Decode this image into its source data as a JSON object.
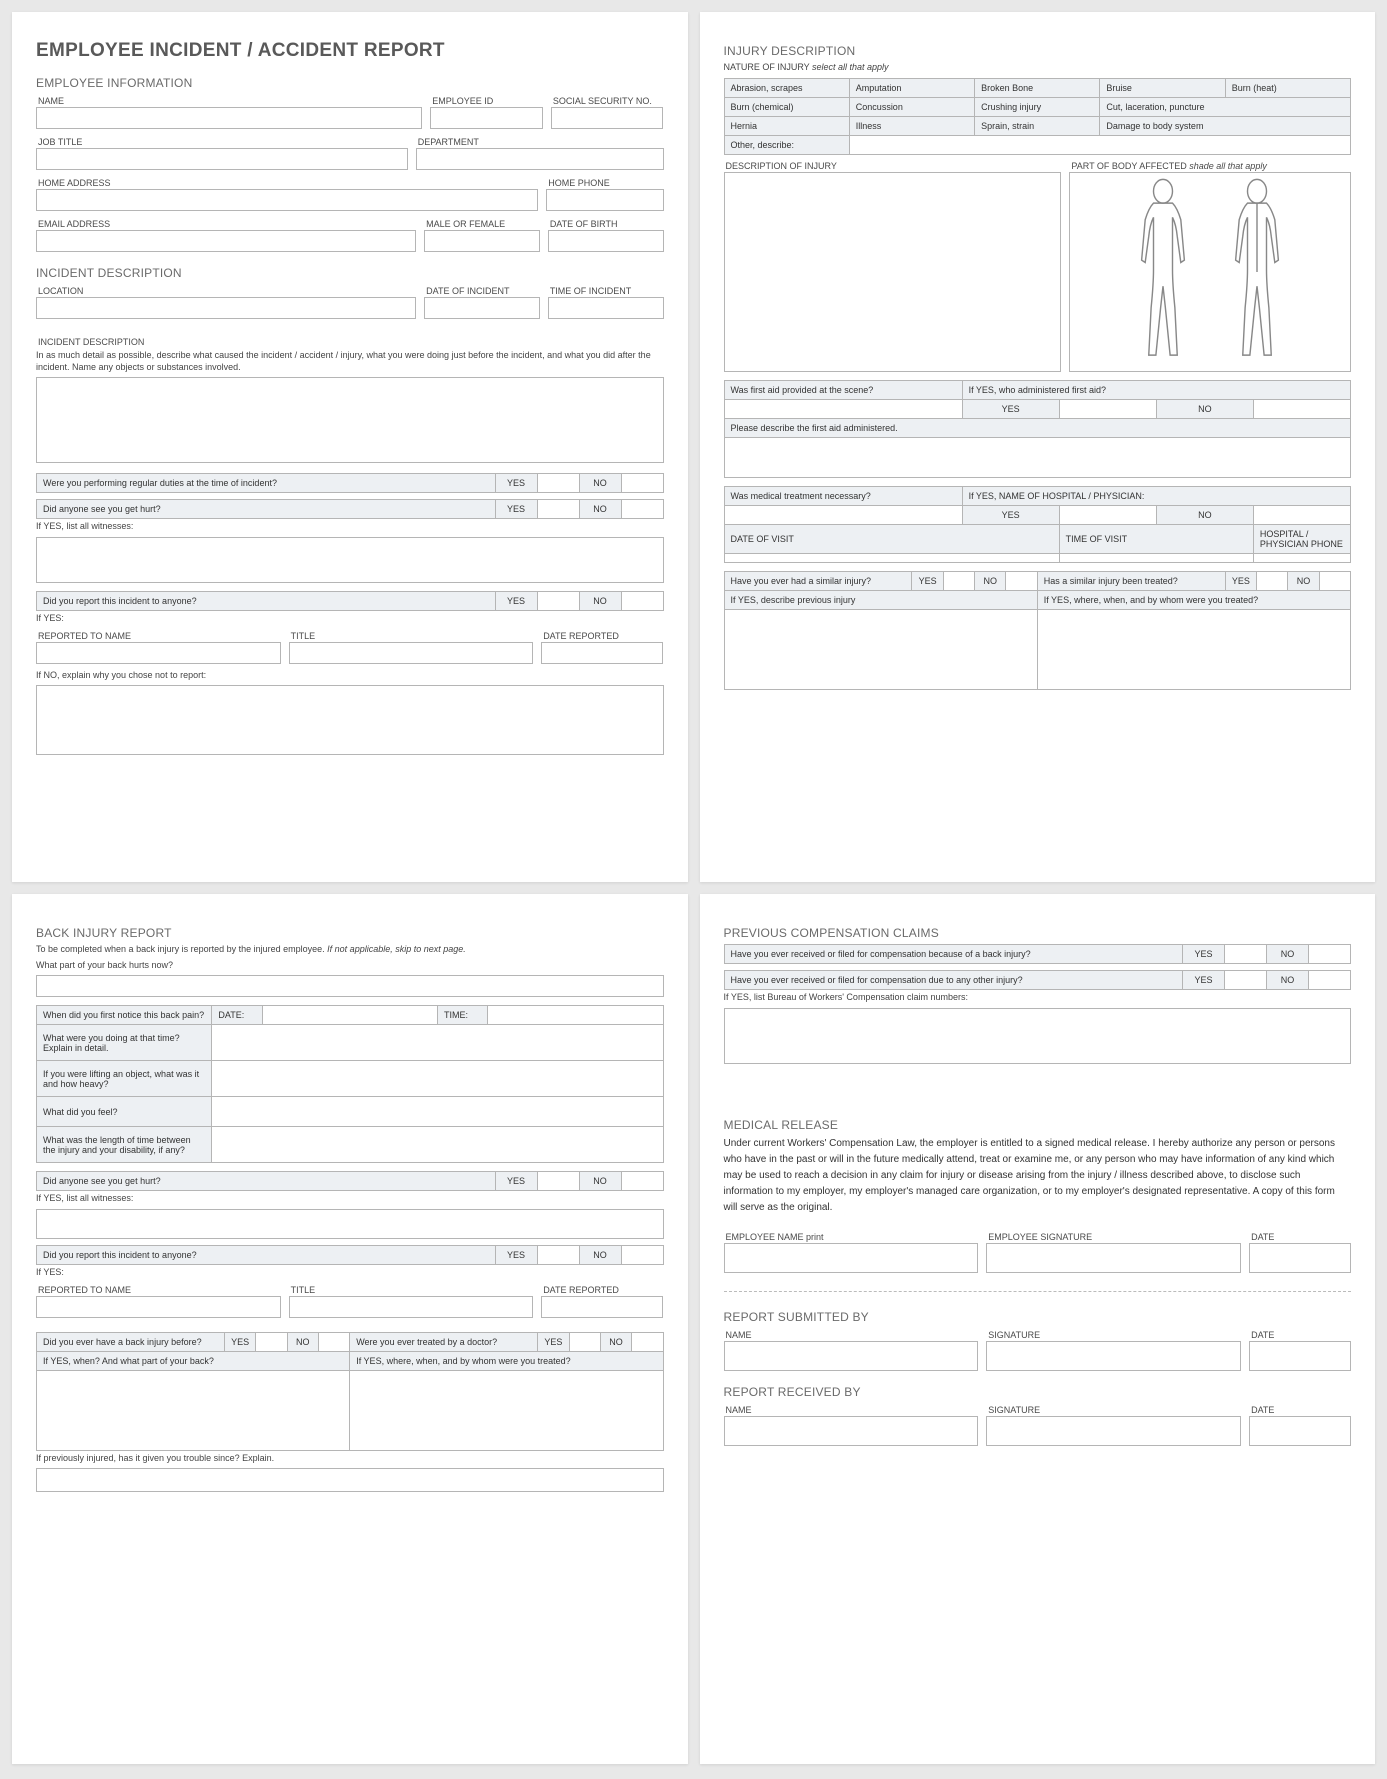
{
  "title": "EMPLOYEE INCIDENT / ACCIDENT REPORT",
  "sections": {
    "emp_info": "EMPLOYEE INFORMATION",
    "incident_desc": "INCIDENT DESCRIPTION",
    "back_injury": "BACK INJURY REPORT",
    "injury_desc": "INJURY DESCRIPTION",
    "prev_comp": "PREVIOUS COMPENSATION CLAIMS",
    "med_release": "MEDICAL RELEASE",
    "submitted": "REPORT SUBMITTED BY",
    "received": "REPORT RECEIVED BY"
  },
  "labels": {
    "name": "NAME",
    "emp_id": "EMPLOYEE ID",
    "ssn": "SOCIAL SECURITY NO.",
    "job_title": "JOB TITLE",
    "department": "DEPARTMENT",
    "home_addr": "HOME ADDRESS",
    "home_phone": "HOME PHONE",
    "email": "EMAIL ADDRESS",
    "mf": "MALE OR FEMALE",
    "dob": "DATE OF BIRTH",
    "location": "LOCATION",
    "date_inc": "DATE OF INCIDENT",
    "time_inc": "TIME OF INCIDENT",
    "incident_desc_lbl": "INCIDENT DESCRIPTION",
    "incident_help": "In as much detail as possible, describe what caused the incident / accident / injury, what you were doing just before the incident, and what you did after the incident.  Name any objects or substances involved.",
    "q_regular_duties": "Were you performing regular duties at the time of incident?",
    "q_seen_hurt": "Did anyone see you get hurt?",
    "if_yes_witnesses": "If YES, list all witnesses:",
    "q_reported": "Did you report this incident to anyone?",
    "if_yes": "If YES:",
    "reported_to": "REPORTED TO NAME",
    "title_lbl": "TITLE",
    "date_reported": "DATE REPORTED",
    "if_no_explain": "If NO, explain why you chose not to report:",
    "back_note": "To be completed when a back injury is reported by the injured employee.  ",
    "back_note_italic": "If not applicable, skip to next page.",
    "back_q_part": "What part of your back hurts now?",
    "back_q_notice": "When did you first notice this back pain?",
    "date": "DATE:",
    "time": "TIME:",
    "back_q_doing": "What were you doing at that time?  Explain in detail.",
    "back_q_lifting": "If you were lifting an object, what was it and how heavy?",
    "back_q_feel": "What did you feel?",
    "back_q_length": "What was the length of time between the injury and your disability, if any?",
    "back_q_before": "Did you ever have a back injury before?",
    "back_q_treated": "Were you ever treated by a doctor?",
    "back_q_when": "If YES, when? And what part of your back?",
    "back_q_where_treated": "If YES, where, when, and by whom were you treated?",
    "back_q_prev_trouble": "If previously injured, has it given you trouble since?  Explain.",
    "nature_lbl": "NATURE OF INJURY  ",
    "nature_italic": "select all that apply",
    "desc_of_injury": "DESCRIPTION OF INJURY",
    "body_affected": "PART OF BODY AFFECTED  ",
    "body_italic": "shade all that apply",
    "q_first_aid": "Was first aid provided at the scene?",
    "q_first_aid_who": "If YES, who administered first aid?",
    "q_first_aid_desc": "Please describe the first aid administered.",
    "q_med_treat": "Was medical treatment necessary?",
    "q_hosp_name": "If YES, NAME OF HOSPITAL / PHYSICIAN:",
    "date_visit": "DATE OF VISIT",
    "time_visit": "TIME OF VISIT",
    "hosp_phone": "HOSPITAL / PHYSICIAN PHONE",
    "q_similar": "Have you ever had a similar injury?",
    "q_similar_treated": "Has a similar injury been treated?",
    "q_similar_prev": "If YES, describe previous injury",
    "q_similar_where": "If YES, where, when, and by whom were you treated?",
    "q_comp_back": "Have you ever received or filed for compensation because of a back injury?",
    "q_comp_other": "Have you ever received or filed for compensation due to any other injury?",
    "q_comp_list": "If YES, list Bureau of Workers' Compensation claim numbers:",
    "release_text": "Under current Workers' Compensation Law, the employer is entitled to a signed medical release.  I hereby authorize any person or persons who have in the past or will in the future medically attend, treat or examine me, or any person who may have information of any kind which may be used to reach a decision in any claim for injury or disease arising from the injury / illness described above, to disclose such information to my employer, my employer's managed care organization, or to my employer's designated representative.  A copy of this form will serve as the original.",
    "emp_name_print": "EMPLOYEE NAME  print",
    "emp_sig": "EMPLOYEE SIGNATURE",
    "date_lbl": "DATE",
    "sig": "SIGNATURE",
    "yes": "YES",
    "no": "NO"
  },
  "injury_types": [
    [
      "Abrasion, scrapes",
      "Amputation",
      "Broken Bone",
      "Bruise",
      "Burn (heat)"
    ],
    [
      "Burn (chemical)",
      "Concussion",
      "Crushing injury",
      "Cut, laceration, puncture",
      ""
    ],
    [
      "Hernia",
      "Illness",
      "Sprain, strain",
      "Damage to body system",
      ""
    ],
    [
      "Other, describe:",
      "",
      "",
      "",
      ""
    ]
  ]
}
